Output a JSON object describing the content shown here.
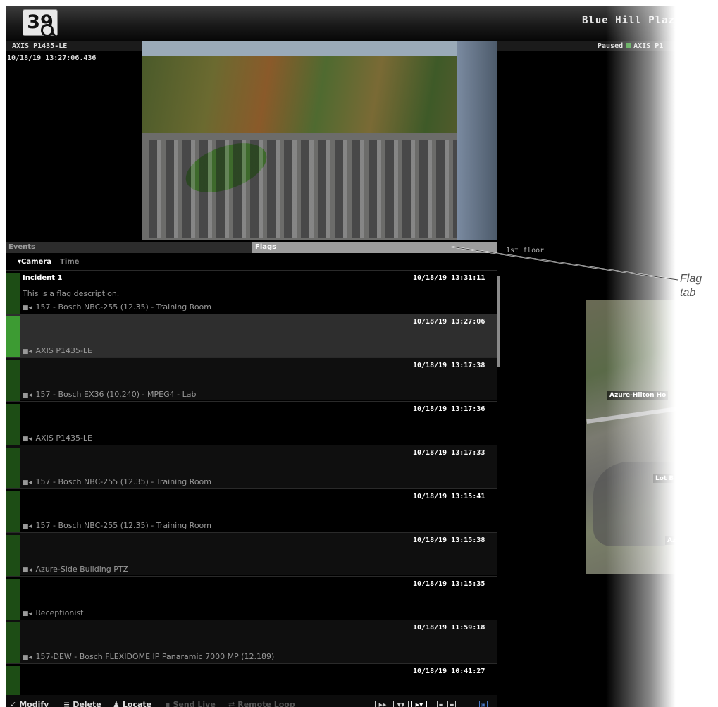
{
  "app": {
    "logo_number": "39",
    "site_title": "Blue Hill Plaza"
  },
  "camera": {
    "name": "AXIS P1435-LE",
    "timestamp": "10/18/19 13:27:06.436",
    "status": "Paused",
    "status_color": "#3c9a36",
    "tile_name": "AXIS P1"
  },
  "tabs": {
    "events": "Events",
    "flags": "Flags"
  },
  "floor_label": "1st floor",
  "sort": {
    "camera": "▾Camera",
    "time": "Time"
  },
  "flags": [
    {
      "title": "Incident 1",
      "description": "This is a flag description.",
      "camera": "157 - Bosch NBC-255 (12.35) - Training Room",
      "time": "10/18/19 13:31:11"
    },
    {
      "title": "",
      "description": "",
      "camera": "AXIS P1435-LE",
      "time": "10/18/19 13:27:06"
    },
    {
      "title": "",
      "description": "",
      "camera": "157 - Bosch EX36 (10.240) - MPEG4 - Lab",
      "time": "10/18/19 13:17:38"
    },
    {
      "title": "",
      "description": "",
      "camera": "AXIS P1435-LE",
      "time": "10/18/19 13:17:36"
    },
    {
      "title": "",
      "description": "",
      "camera": "157 - Bosch NBC-255 (12.35) - Training Room",
      "time": "10/18/19 13:17:33"
    },
    {
      "title": "",
      "description": "",
      "camera": "157 - Bosch NBC-255 (12.35) - Training Room",
      "time": "10/18/19 13:15:41"
    },
    {
      "title": "",
      "description": "",
      "camera": "Azure-Side Building PTZ",
      "time": "10/18/19 13:15:38"
    },
    {
      "title": "",
      "description": "",
      "camera": "Receptionist",
      "time": "10/18/19 13:15:35"
    },
    {
      "title": "",
      "description": "",
      "camera": "157-DEW - Bosch FLEXIDOME IP Panaramic 7000 MP (12.189)",
      "time": "10/18/19 11:59:18"
    },
    {
      "title": "",
      "description": "",
      "camera": "",
      "time": "10/18/19 10:41:27"
    }
  ],
  "toolbar": {
    "modify": "Modify",
    "delete": "Delete",
    "locate": "Locate",
    "send_live": "Send Live",
    "remote_loop": "Remote Loop"
  },
  "map": {
    "labels": [
      "Azure-Hilton Ho",
      "Lot B",
      "Azu"
    ]
  },
  "callout": {
    "line1": "Flag",
    "line2": "tab"
  }
}
